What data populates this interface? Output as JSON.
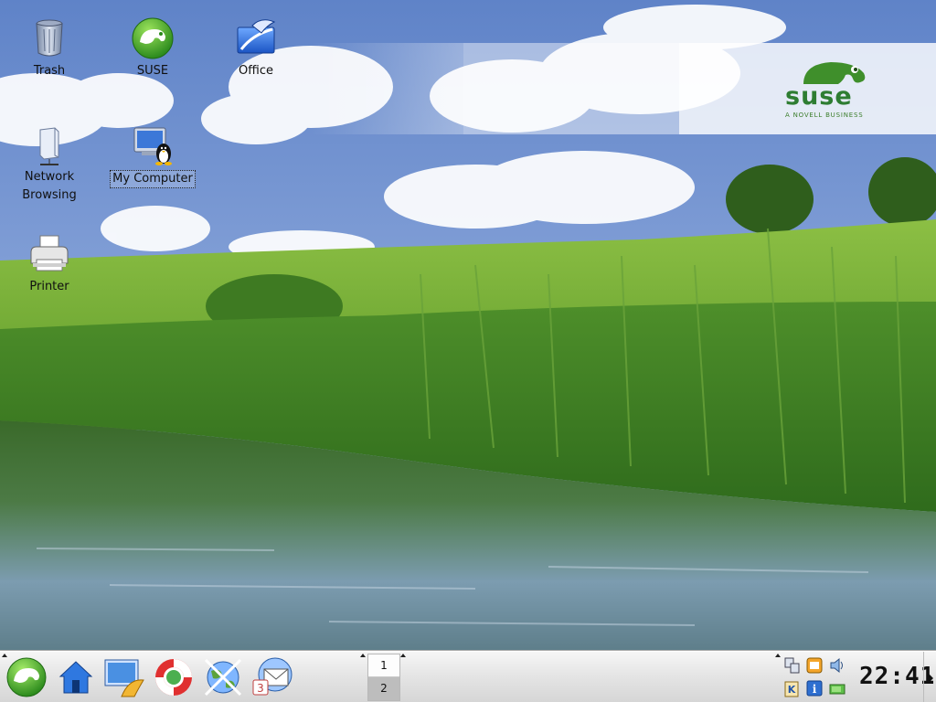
{
  "desktop": {
    "icons": [
      {
        "id": "trash",
        "label": "Trash",
        "icon": "trash-icon"
      },
      {
        "id": "suse",
        "label": "SUSE",
        "icon": "suse-icon"
      },
      {
        "id": "office",
        "label": "Office",
        "icon": "office-icon"
      },
      {
        "id": "network",
        "label": "Network\nBrowsing",
        "icon": "network-icon"
      },
      {
        "id": "my-computer",
        "label": "My Computer",
        "icon": "computer-icon",
        "selected": true
      },
      {
        "id": "printer",
        "label": "Printer",
        "icon": "printer-icon"
      }
    ],
    "banner": {
      "wordmark": "suse",
      "tagline": "A NOVELL BUSINESS"
    }
  },
  "taskbar": {
    "launchers": [
      {
        "name": "suse-menu-button",
        "icon": "suse-gecko-icon"
      },
      {
        "name": "home-button",
        "icon": "home-icon"
      },
      {
        "name": "desktop-button",
        "icon": "desktop-shell-icon"
      },
      {
        "name": "help-button",
        "icon": "lifebuoy-icon"
      },
      {
        "name": "browser-button",
        "icon": "konqueror-icon"
      },
      {
        "name": "mail-button",
        "icon": "kontact-mail-icon"
      }
    ],
    "pager": {
      "desktops": [
        "1",
        "2"
      ],
      "active": "2"
    },
    "tray": [
      {
        "name": "network-tray",
        "icon": "network-tray-icon"
      },
      {
        "name": "updater-tray",
        "icon": "updater-icon"
      },
      {
        "name": "volume-tray",
        "icon": "speaker-icon"
      },
      {
        "name": "klipper-tray",
        "icon": "klipper-icon"
      },
      {
        "name": "info-tray",
        "icon": "info-icon"
      },
      {
        "name": "battery-tray",
        "icon": "battery-icon"
      }
    ],
    "clock": "22:41"
  },
  "colors": {
    "sky": "#6e8fc9",
    "grass": "#5d9a2c",
    "water": "#3f6b3a",
    "suse_green": "#2e7d32",
    "taskbar": "#e4e4e4"
  }
}
